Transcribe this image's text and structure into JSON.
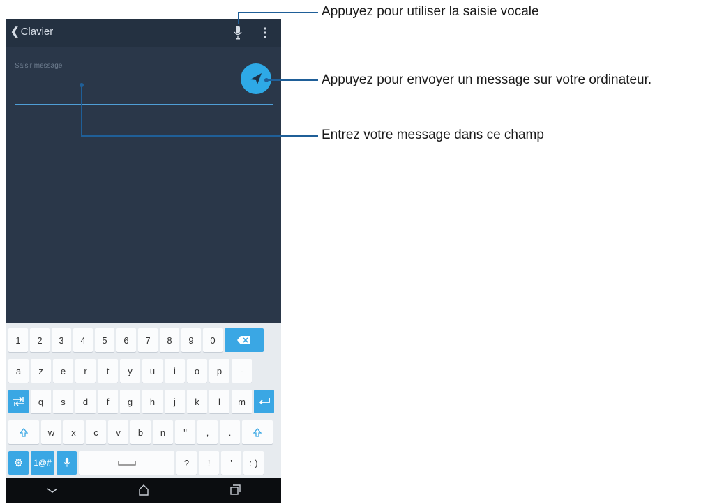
{
  "topbar": {
    "back_label": "Clavier"
  },
  "message": {
    "placeholder": "Saisir message"
  },
  "keyboard": {
    "row1": [
      "1",
      "2",
      "3",
      "4",
      "5",
      "6",
      "7",
      "8",
      "9",
      "0"
    ],
    "row2": [
      "a",
      "z",
      "e",
      "r",
      "t",
      "y",
      "u",
      "i",
      "o",
      "p",
      "-"
    ],
    "row3": [
      "q",
      "s",
      "d",
      "f",
      "g",
      "h",
      "j",
      "k",
      "l",
      "m"
    ],
    "row4": [
      "w",
      "x",
      "c",
      "v",
      "b",
      "n",
      "\"",
      ",",
      "."
    ],
    "row5": {
      "symbols": "1@#",
      "question": "?",
      "exclaim": "!",
      "apostrophe": "'",
      "smiley": ":-)"
    }
  },
  "callouts": {
    "voice": "Appuyez pour utiliser la saisie vocale",
    "send": "Appuyez pour envoyer un message sur votre ordinateur.",
    "field": "Entrez votre message dans ce champ"
  },
  "colors": {
    "accent": "#2ea9e6",
    "background": "#2a3749",
    "callout": "#1f5f98"
  }
}
